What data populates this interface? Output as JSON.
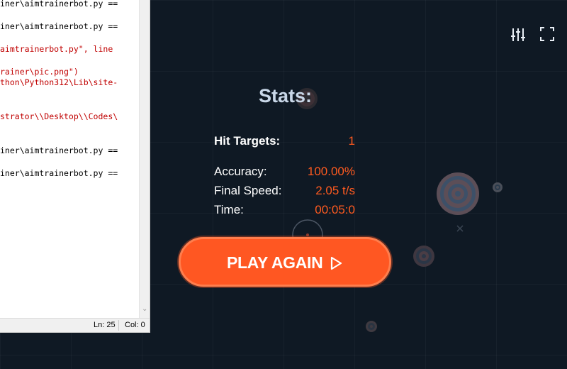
{
  "editor": {
    "lines": [
      {
        "text": "iner\\aimtrainerbot.py ==",
        "color": "black"
      },
      {
        "text": "iner\\aimtrainerbot.py ==",
        "color": "black"
      },
      {
        "text": "aimtrainerbot.py\", line",
        "color": "red"
      },
      {
        "text": "rainer\\pic.png\")",
        "color": "red"
      },
      {
        "text": "thon\\Python312\\Lib\\site-",
        "color": "red"
      },
      {
        "text": "strator\\\\Desktop\\\\Codes\\",
        "color": "red"
      },
      {
        "text": "iner\\aimtrainerbot.py ==",
        "color": "black"
      },
      {
        "text": "iner\\aimtrainerbot.py ==",
        "color": "black"
      }
    ],
    "status": {
      "line": "Ln: 25",
      "col": "Col: 0"
    }
  },
  "icons": {
    "settings": "sliders-icon",
    "fullscreen": "fullscreen-icon"
  },
  "stats": {
    "title": "Stats:",
    "hit_targets_label": "Hit Targets:",
    "hit_targets_value": "1",
    "accuracy_label": "Accuracy:",
    "accuracy_value": "100.00%",
    "final_speed_label": "Final Speed:",
    "final_speed_value": "2.05 t/s",
    "time_label": "Time:",
    "time_value": "00:05:0"
  },
  "play_button": {
    "label": "PLAY AGAIN"
  },
  "colors": {
    "accent": "#ff5722",
    "background": "#0f1924",
    "stat_value": "#ff5a1f"
  }
}
